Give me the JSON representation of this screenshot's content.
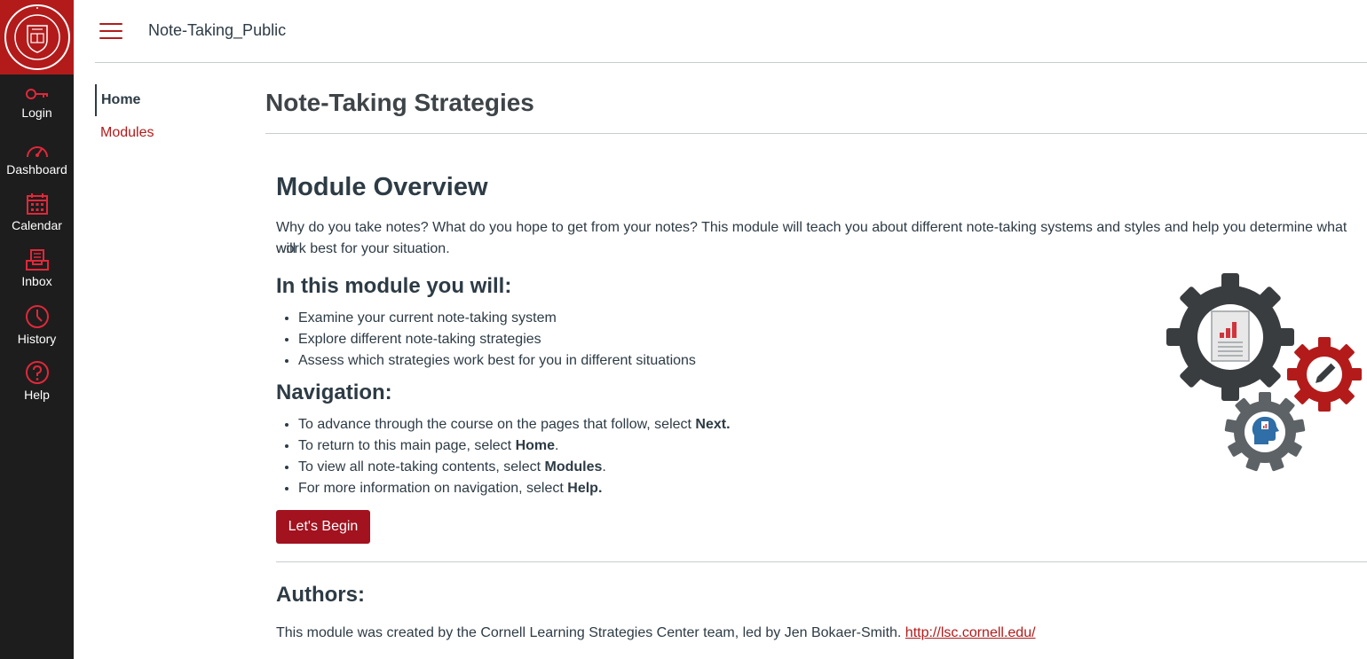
{
  "nav": {
    "logo_icon": "cornell-seal-icon",
    "items": [
      {
        "label": "Login",
        "icon": "key-icon"
      },
      {
        "label": "Dashboard",
        "icon": "speedometer-icon"
      },
      {
        "label": "Calendar",
        "icon": "calendar-icon"
      },
      {
        "label": "Inbox",
        "icon": "inbox-icon"
      },
      {
        "label": "History",
        "icon": "clock-icon"
      },
      {
        "label": "Help",
        "icon": "question-icon"
      }
    ]
  },
  "header": {
    "course_title": "Note-Taking_Public"
  },
  "course_nav": {
    "items": [
      {
        "label": "Home",
        "active": true
      },
      {
        "label": "Modules",
        "active": false
      }
    ]
  },
  "page": {
    "title": "Note-Taking Strategies",
    "overview_heading": "Module Overview",
    "overview_text_1": "Why do you take notes? What do you hope to get from your notes? This module will teach you about different note-taking systems and styles and help you determine what will",
    "overview_text_2": "work best for your situation.",
    "goals_heading": "In this module you will:",
    "goals": [
      "Examine your current note-taking system",
      "Explore different note-taking strategies",
      "Assess which strategies work best for you in different situations"
    ],
    "navigation_heading": "Navigation:",
    "navigation_items": [
      {
        "prefix": "To advance through the course on the pages that follow, select ",
        "bold": "Next.",
        "suffix": ""
      },
      {
        "prefix": "To return to this main page, select ",
        "bold": "Home",
        "suffix": "."
      },
      {
        "prefix": "To view all note-taking contents, select ",
        "bold": "Modules",
        "suffix": "."
      },
      {
        "prefix": "For more information on navigation, select ",
        "bold": "Help.",
        "suffix": ""
      }
    ],
    "begin_button": "Let's Begin",
    "authors_heading": "Authors:",
    "authors_text": "This module was created by the Cornell Learning Strategies Center team, led by Jen Bokaer-Smith. ",
    "authors_link": "http://lsc.cornell.edu/"
  },
  "colors": {
    "brand_red": "#b31b1b",
    "button_red": "#a2121f",
    "nav_background": "#1d1d1d",
    "text": "#2d3b45"
  }
}
